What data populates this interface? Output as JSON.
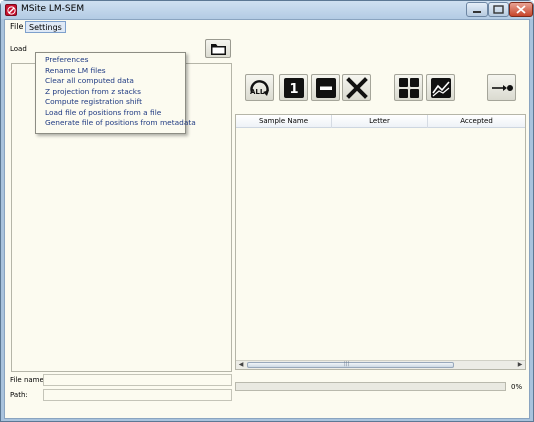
{
  "window": {
    "title": "MSite LM-SEM"
  },
  "menubar": {
    "file": "File",
    "settings": "Settings"
  },
  "settings_menu": [
    "Preferences",
    "Rename LM files",
    "Clear all computed data",
    "Z projection from z stacks",
    "Compute registration shift",
    "Load file of positions from a file",
    "Generate file of positions from metadata"
  ],
  "left": {
    "load_label": "Load"
  },
  "table": {
    "columns": [
      "Sample Name",
      "Letter",
      "Accepted"
    ],
    "rows": []
  },
  "fields": {
    "file_name_label": "File name:",
    "path_label": "Path:"
  },
  "progress": {
    "value": 0,
    "text": "0%"
  },
  "toolbar": {
    "all_label": "ALL",
    "one_label": "1",
    "icons": [
      "folder-icon",
      "all-icon",
      "one-icon",
      "minus-icon",
      "cross-icon",
      "grid-icon",
      "chart-icon",
      "arrow-point-icon"
    ]
  },
  "colors": {
    "menu_text": "#1f3a82",
    "progress": "#4fbf4f",
    "background": "#fcfbf0"
  }
}
